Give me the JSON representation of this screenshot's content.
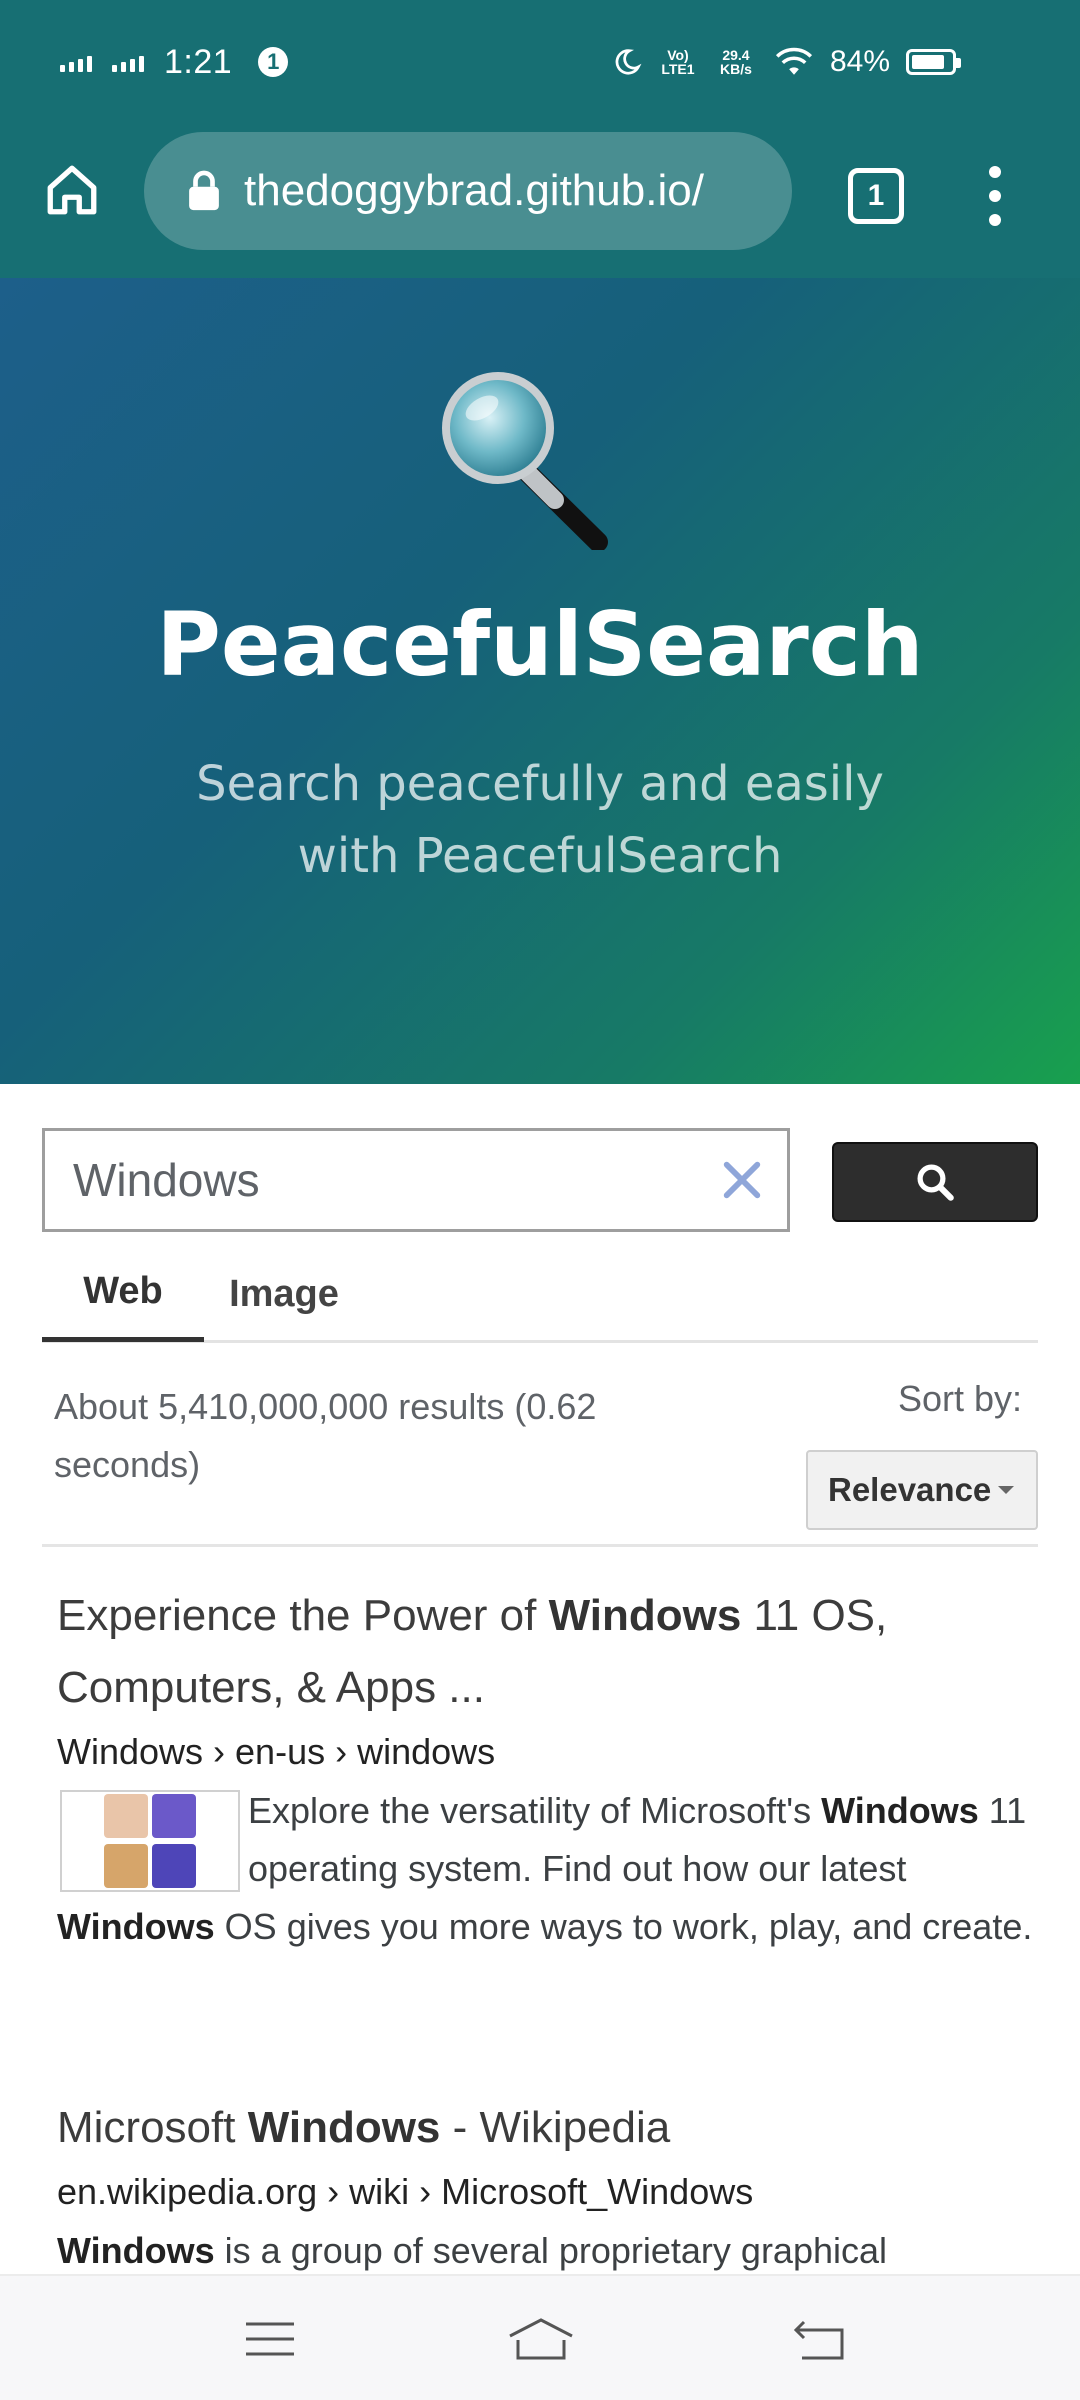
{
  "status_bar": {
    "time": "1:21",
    "alert_badge": "1",
    "network_type": "Vo) LTE1",
    "speed": "29.4 KB/s",
    "battery": "84%",
    "battery_level": 0.84
  },
  "browser": {
    "url": "thedoggybrad.github.io/",
    "tab_count": "1"
  },
  "hero": {
    "brand": "PeacefulSearch",
    "tagline": "Search peacefully and easily with PeacefulSearch"
  },
  "search": {
    "query": "Windows",
    "tabs": [
      "Web",
      "Image"
    ],
    "active_tab": "Web"
  },
  "results_meta": {
    "stats": "About 5,410,000,000 results (0.62 seconds)",
    "sort_label": "Sort by:",
    "sort_value": "Relevance"
  },
  "results": [
    {
      "title_pre": "Experience the Power of ",
      "title_bold": "Windows",
      "title_post": " 11 OS, Computers, & Apps ...",
      "crumb": "Windows › en-us › windows",
      "snippet_1": "Explore the versatility of Microsoft's ",
      "snippet_b1": "Windows",
      "snippet_2": " 11 operating system. Find out how our latest ",
      "snippet_b2": "Windows",
      "snippet_3": " OS gives you more ways to work, play, and create."
    },
    {
      "title_pre": "Microsoft ",
      "title_bold": "Windows",
      "title_post": " - Wikipedia",
      "crumb": "en.wikipedia.org › wiki › Microsoft_Windows",
      "snippet_b1": "Windows",
      "snippet_1": " is a group of several proprietary graphical"
    }
  ],
  "colors": {
    "chrome": "#176f73",
    "hero_start": "#1d5f8a",
    "hero_end": "#18a04e",
    "search_button": "#2d2d2d"
  },
  "icons": {
    "home": "home-icon",
    "lock": "lock-icon",
    "menu": "more-vert-icon",
    "clear": "close-icon",
    "search": "search-icon",
    "nav_recents": "menu-lines-icon",
    "nav_home": "home-outline-icon",
    "nav_back": "back-icon"
  }
}
